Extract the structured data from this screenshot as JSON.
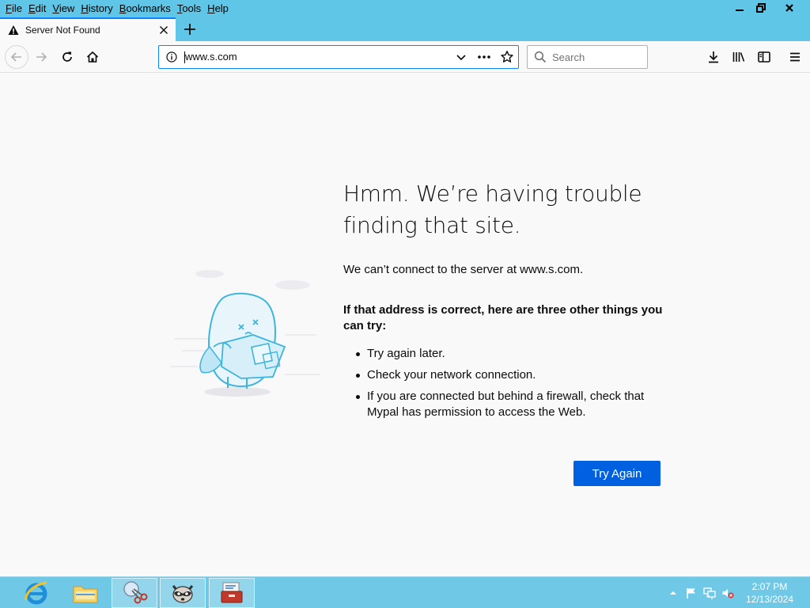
{
  "menu": {
    "items": [
      {
        "u": "F",
        "rest": "ile"
      },
      {
        "u": "E",
        "rest": "dit"
      },
      {
        "u": "V",
        "rest": "iew"
      },
      {
        "u": "H",
        "rest": "istory"
      },
      {
        "u": "B",
        "rest": "ookmarks"
      },
      {
        "u": "T",
        "rest": "ools"
      },
      {
        "u": "H",
        "rest": "elp"
      }
    ]
  },
  "tab": {
    "title": "Server Not Found"
  },
  "urlbar": {
    "url": "www.s.com"
  },
  "search": {
    "placeholder": "Search"
  },
  "error": {
    "title": "Hmm. We’re having trouble finding that site.",
    "description": "We can’t connect to the server at www.s.com.",
    "tips_heading": "If that address is correct, here are three other things you can try:",
    "tips": [
      "Try again later.",
      "Check your network connection.",
      "If you are connected but behind a firewall, check that Mypal has permission to access the Web."
    ],
    "button_label": "Try Again"
  },
  "taskbar": {
    "apps": [
      "internet-explorer-icon",
      "file-explorer-icon",
      "snipping-tool-icon",
      "mypal-raccoon-icon",
      "toolbox-icon"
    ],
    "clock_time": "2:07 PM",
    "clock_date": "12/13/2024"
  },
  "colors": {
    "titlebar": "#5fc6e8",
    "accent": "#0a84ff",
    "button": "#0060df",
    "taskbar": "#6fc8e6"
  }
}
